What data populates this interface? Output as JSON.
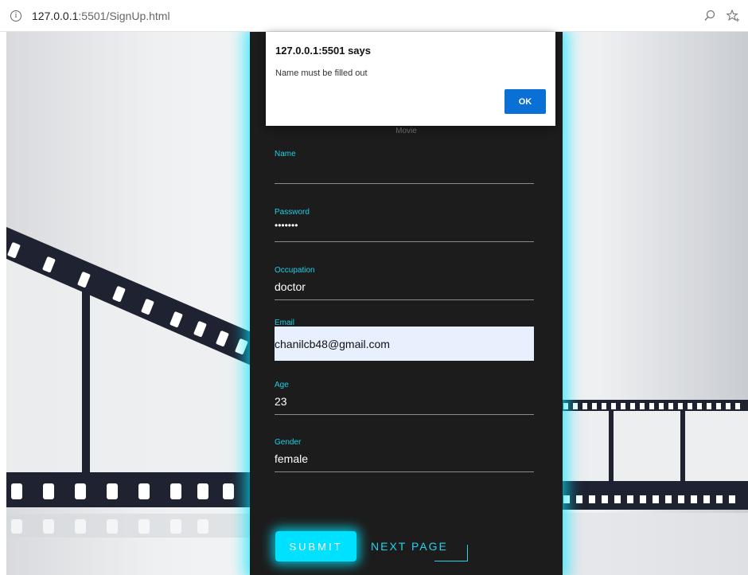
{
  "browser": {
    "info_icon": "info-icon",
    "url_host": "127.0.0.1",
    "url_path": ":5501/SignUp.html",
    "zoom_icon": "search-zoom-icon",
    "favorite_icon": "favorite-star-icon"
  },
  "alert": {
    "title": "127.0.0.1:5501 says",
    "message": "Name must be filled out",
    "ok_label": "OK"
  },
  "form": {
    "title": "Movie",
    "fields": [
      {
        "label": "Name",
        "value": ""
      },
      {
        "label": "Password",
        "value": "•••••••"
      },
      {
        "label": "Occupation",
        "value": "doctor"
      },
      {
        "label": "Email",
        "value": "chanilcb48@gmail.com"
      },
      {
        "label": "Age",
        "value": "23"
      },
      {
        "label": "Gender",
        "value": "female"
      }
    ],
    "submit_label": "SUBMIT",
    "next_label": "NEXT PAGE"
  },
  "colors": {
    "accent": "#00e0ff",
    "card_bg": "#1c1c1c",
    "ok_button": "#0a70d6"
  }
}
